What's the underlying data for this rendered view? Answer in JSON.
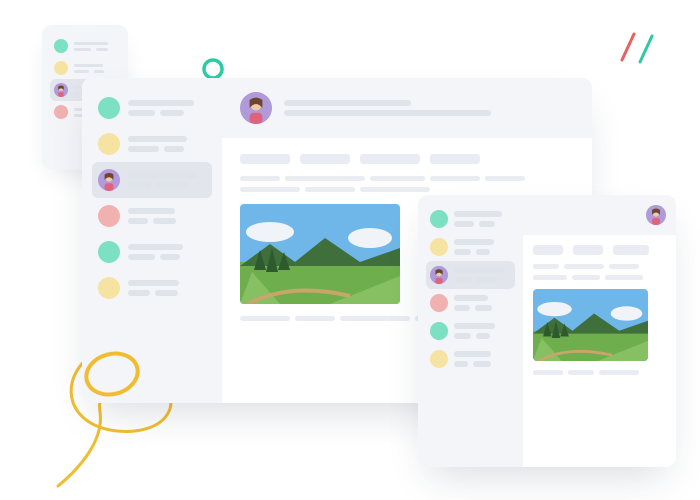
{
  "palette": {
    "bg_panel": "#f3f5f8",
    "divider": "#e2e6ec",
    "placeholder": "#dfe3ea",
    "placeholder_light": "#e9ecf2",
    "accent_yellow": "#f1bd30",
    "accent_teal": "#2fc9a4",
    "accent_red": "#e86060",
    "accent_yellow_soft": "#f6e3a1",
    "accent_red_soft": "#f2b1b1"
  },
  "decorations": {
    "circle_outline": {
      "color": "#2fc9a4"
    },
    "slash_pair": {
      "colors": [
        "#e86060",
        "#2fc9a4"
      ]
    },
    "squiggle_line": {
      "color": "#f1bd30"
    },
    "oval_outline": {
      "color": "#f1bd30"
    }
  },
  "windows": [
    {
      "id": "win-a",
      "role": "sidebar-only-preview-small",
      "sidebar": {
        "items": [
          {
            "avatar_type": "dot",
            "avatar_color": "#7ce0c3",
            "active": false
          },
          {
            "avatar_type": "dot",
            "avatar_color": "#f6e3a1",
            "active": false
          },
          {
            "avatar_type": "photo",
            "active": true
          },
          {
            "avatar_type": "dot",
            "avatar_color": "#f2b1b1",
            "active": false
          }
        ]
      }
    },
    {
      "id": "win-b",
      "role": "messaging-window-large",
      "sidebar": {
        "items": [
          {
            "avatar_type": "dot",
            "avatar_color": "#7ce0c3",
            "active": false
          },
          {
            "avatar_type": "dot",
            "avatar_color": "#f6e3a1",
            "active": false
          },
          {
            "avatar_type": "photo",
            "active": true
          },
          {
            "avatar_type": "dot",
            "avatar_color": "#f2b1b1",
            "active": false
          },
          {
            "avatar_type": "dot",
            "avatar_color": "#7ce0c3",
            "active": false
          },
          {
            "avatar_type": "dot",
            "avatar_color": "#f6e3a1",
            "active": false
          }
        ]
      },
      "content": {
        "header_avatar": "photo",
        "attached_image": "landscape-photo"
      }
    },
    {
      "id": "win-c",
      "role": "messaging-window-small",
      "sidebar": {
        "items": [
          {
            "avatar_type": "dot",
            "avatar_color": "#7ce0c3",
            "active": false
          },
          {
            "avatar_type": "dot",
            "avatar_color": "#f6e3a1",
            "active": false
          },
          {
            "avatar_type": "photo",
            "active": true
          },
          {
            "avatar_type": "dot",
            "avatar_color": "#f2b1b1",
            "active": false
          },
          {
            "avatar_type": "dot",
            "avatar_color": "#7ce0c3",
            "active": false
          },
          {
            "avatar_type": "dot",
            "avatar_color": "#f6e3a1",
            "active": false
          }
        ]
      },
      "content": {
        "header_avatar": "photo",
        "attached_image": "landscape-photo"
      }
    }
  ]
}
